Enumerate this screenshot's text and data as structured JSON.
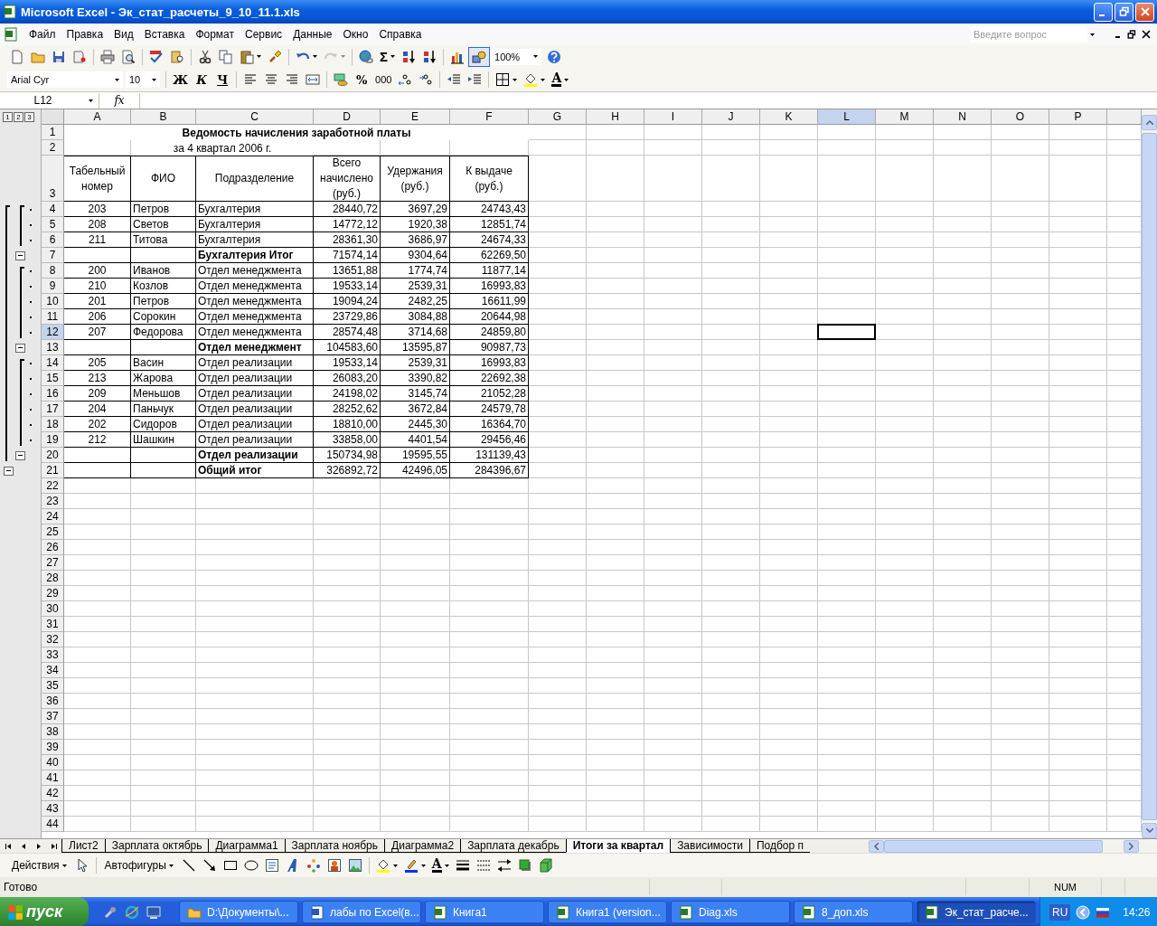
{
  "window": {
    "title": "Microsoft Excel - Эк_стат_расчеты_9_10_11.1.xls"
  },
  "menu": [
    "Файл",
    "Правка",
    "Вид",
    "Вставка",
    "Формат",
    "Сервис",
    "Данные",
    "Окно",
    "Справка"
  ],
  "help_search": {
    "placeholder": "Введите вопрос"
  },
  "standard_toolbar": {
    "sum": "Σ",
    "zoom": "100%",
    "drawing_on": true,
    "redo_disabled": true
  },
  "formatting_toolbar": {
    "font": "Arial Cyr",
    "size": "10",
    "bold": "Ж",
    "italic": "К",
    "underline": "Ч",
    "percent": "%",
    "thousands": "000",
    "font_color": "A"
  },
  "formula_bar": {
    "name_box": "L12",
    "function_label": "fx"
  },
  "sheet": {
    "outline_levels": [
      "1",
      "2",
      "3"
    ],
    "columns": [
      {
        "label": "A",
        "selected": false
      },
      {
        "label": "B",
        "selected": false
      },
      {
        "label": "C",
        "selected": false
      },
      {
        "label": "D",
        "selected": false
      },
      {
        "label": "E",
        "selected": false
      },
      {
        "label": "F",
        "selected": false
      },
      {
        "label": "G",
        "selected": false
      },
      {
        "label": "H",
        "selected": false
      },
      {
        "label": "I",
        "selected": false
      },
      {
        "label": "J",
        "selected": false
      },
      {
        "label": "K",
        "selected": false
      },
      {
        "label": "L",
        "selected": true
      },
      {
        "label": "M",
        "selected": false
      },
      {
        "label": "N",
        "selected": false
      },
      {
        "label": "O",
        "selected": false
      },
      {
        "label": "P",
        "selected": false
      }
    ],
    "rows": [
      {
        "label": "1",
        "selected": false
      },
      {
        "label": "2",
        "selected": false
      },
      {
        "label": "3",
        "selected": false
      },
      {
        "label": "4",
        "selected": false
      },
      {
        "label": "5",
        "selected": false
      },
      {
        "label": "6",
        "selected": false
      },
      {
        "label": "7",
        "selected": false
      },
      {
        "label": "8",
        "selected": false
      },
      {
        "label": "9",
        "selected": false
      },
      {
        "label": "10",
        "selected": false
      },
      {
        "label": "11",
        "selected": false
      },
      {
        "label": "12",
        "selected": true
      },
      {
        "label": "13",
        "selected": false
      },
      {
        "label": "14",
        "selected": false
      },
      {
        "label": "15",
        "selected": false
      },
      {
        "label": "16",
        "selected": false
      },
      {
        "label": "17",
        "selected": false
      },
      {
        "label": "18",
        "selected": false
      },
      {
        "label": "19",
        "selected": false
      },
      {
        "label": "20",
        "selected": false
      },
      {
        "label": "21",
        "selected": false
      },
      {
        "label": "22",
        "selected": false
      },
      {
        "label": "23",
        "selected": false
      },
      {
        "label": "24",
        "selected": false
      },
      {
        "label": "25",
        "selected": false
      },
      {
        "label": "26",
        "selected": false
      },
      {
        "label": "27",
        "selected": false
      },
      {
        "label": "28",
        "selected": false
      },
      {
        "label": "29",
        "selected": false
      },
      {
        "label": "30",
        "selected": false
      },
      {
        "label": "31",
        "selected": false
      },
      {
        "label": "32",
        "selected": false
      },
      {
        "label": "33",
        "selected": false
      },
      {
        "label": "34",
        "selected": false
      },
      {
        "label": "35",
        "selected": false
      },
      {
        "label": "36",
        "selected": false
      },
      {
        "label": "37",
        "selected": false
      },
      {
        "label": "38",
        "selected": false
      },
      {
        "label": "39",
        "selected": false
      },
      {
        "label": "40",
        "selected": false
      },
      {
        "label": "41",
        "selected": false
      },
      {
        "label": "42",
        "selected": false
      },
      {
        "label": "43",
        "selected": false
      },
      {
        "label": "44",
        "selected": false
      }
    ],
    "title": "Ведомость начисления заработной платы",
    "period": "за 4 квартал 2006 г.",
    "table": {
      "header": [
        "Табельный номер",
        "ФИО",
        "Подразделение",
        "Всего начислено (руб.)",
        "Удержания (руб.)",
        "К выдаче (руб.)"
      ],
      "rows": [
        {
          "id": "203",
          "name": "Петров",
          "department": "Бухгалтерия",
          "accrued": "28440,72",
          "deducted": "3697,29",
          "payout": "24743,43",
          "kind": "detail"
        },
        {
          "id": "208",
          "name": "Светов",
          "department": "Бухгалтерия",
          "accrued": "14772,12",
          "deducted": "1920,38",
          "payout": "12851,74",
          "kind": "detail"
        },
        {
          "id": "211",
          "name": "Титова",
          "department": "Бухгалтерия",
          "accrued": "28361,30",
          "deducted": "3686,97",
          "payout": "24674,33",
          "kind": "detail"
        },
        {
          "department": "Бухгалтерия Итог",
          "accrued": "71574,14",
          "deducted": "9304,64",
          "payout": "62269,50",
          "kind": "subtotal"
        },
        {
          "id": "200",
          "name": "Иванов",
          "department": "Отдел менеджмента",
          "accrued": "13651,88",
          "deducted": "1774,74",
          "payout": "11877,14",
          "kind": "detail"
        },
        {
          "id": "210",
          "name": "Козлов",
          "department": "Отдел менеджмента",
          "accrued": "19533,14",
          "deducted": "2539,31",
          "payout": "16993,83",
          "kind": "detail"
        },
        {
          "id": "201",
          "name": "Петров",
          "department": "Отдел менеджмента",
          "accrued": "19094,24",
          "deducted": "2482,25",
          "payout": "16611,99",
          "kind": "detail"
        },
        {
          "id": "206",
          "name": "Сорокин",
          "department": "Отдел менеджмента",
          "accrued": "23729,86",
          "deducted": "3084,88",
          "payout": "20644,98",
          "kind": "detail"
        },
        {
          "id": "207",
          "name": "Федорова",
          "department": "Отдел менеджмента",
          "accrued": "28574,48",
          "deducted": "3714,68",
          "payout": "24859,80",
          "kind": "detail"
        },
        {
          "department": "Отдел менеджмент",
          "accrued": "104583,60",
          "deducted": "13595,87",
          "payout": "90987,73",
          "kind": "subtotal"
        },
        {
          "id": "205",
          "name": "Васин",
          "department": "Отдел реализации",
          "accrued": "19533,14",
          "deducted": "2539,31",
          "payout": "16993,83",
          "kind": "detail"
        },
        {
          "id": "213",
          "name": "Жарова",
          "department": "Отдел реализации",
          "accrued": "26083,20",
          "deducted": "3390,82",
          "payout": "22692,38",
          "kind": "detail"
        },
        {
          "id": "209",
          "name": "Меньшов",
          "department": "Отдел реализации",
          "accrued": "24198,02",
          "deducted": "3145,74",
          "payout": "21052,28",
          "kind": "detail"
        },
        {
          "id": "204",
          "name": "Паньчук",
          "department": "Отдел реализации",
          "accrued": "28252,62",
          "deducted": "3672,84",
          "payout": "24579,78",
          "kind": "detail"
        },
        {
          "id": "202",
          "name": "Сидоров",
          "department": "Отдел реализации",
          "accrued": "18810,00",
          "deducted": "2445,30",
          "payout": "16364,70",
          "kind": "detail"
        },
        {
          "id": "212",
          "name": "Шашкин",
          "department": "Отдел реализации",
          "accrued": "33858,00",
          "deducted": "4401,54",
          "payout": "29456,46",
          "kind": "detail"
        },
        {
          "department": "Отдел реализации",
          "accrued": "150734,98",
          "deducted": "19595,55",
          "payout": "131139,43",
          "kind": "subtotal"
        },
        {
          "department": "Общий итог",
          "accrued": "326892,72",
          "deducted": "42496,05",
          "payout": "284396,67",
          "kind": "total"
        }
      ]
    }
  },
  "sheet_tabs": [
    {
      "label": "Лист2",
      "selected": false
    },
    {
      "label": "Зарплата октябрь",
      "selected": false
    },
    {
      "label": "Диаграмма1",
      "selected": false
    },
    {
      "label": "Зарплата ноябрь",
      "selected": false
    },
    {
      "label": "Диаграмма2",
      "selected": false
    },
    {
      "label": "Зарплата декабрь",
      "selected": false
    },
    {
      "label": "Итоги за квартал",
      "selected": true
    },
    {
      "label": "Зависимости",
      "selected": false
    },
    {
      "label": "Подбор п",
      "selected": false
    }
  ],
  "drawing_toolbar": {
    "actions": "Действия",
    "autoshapes": "Автофигуры",
    "font_color": "A"
  },
  "status_bar": {
    "status": "Готово",
    "num": "NUM"
  },
  "taskbar": {
    "start": "пуск",
    "tasks": [
      {
        "label": "D:\\Документы\\...",
        "kind": "folder",
        "selected": false
      },
      {
        "label": "лабы по Excel(в...",
        "kind": "word",
        "selected": false
      },
      {
        "label": "Книга1",
        "kind": "excel",
        "selected": false
      },
      {
        "label": "Книга1 (version...",
        "kind": "excel",
        "selected": false
      },
      {
        "label": "Diag.xls",
        "kind": "excel",
        "selected": false
      },
      {
        "label": "8_доп.xls",
        "kind": "excel",
        "selected": false
      },
      {
        "label": "Эк_стат_расче...",
        "kind": "excel",
        "selected": true
      }
    ],
    "language": "RU",
    "time": "14:26"
  }
}
